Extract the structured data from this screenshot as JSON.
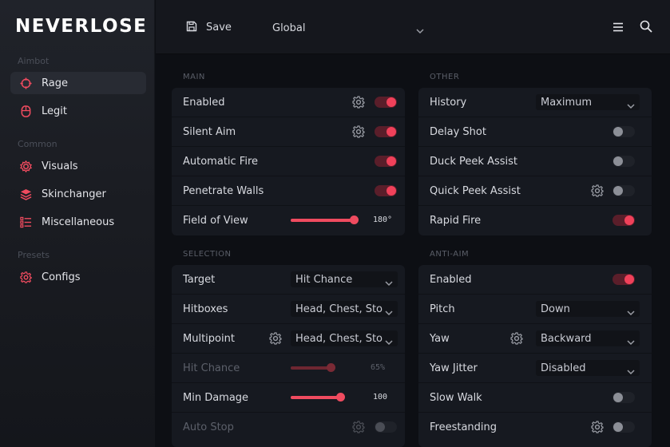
{
  "app": {
    "logo": "NEVERLOSE"
  },
  "sidebar": {
    "sections": [
      {
        "title": "Aimbot",
        "items": [
          {
            "label": "Rage",
            "icon": "crosshair-icon",
            "active": true
          },
          {
            "label": "Legit",
            "icon": "mouse-icon"
          }
        ]
      },
      {
        "title": "Common",
        "items": [
          {
            "label": "Visuals",
            "icon": "sun-icon"
          },
          {
            "label": "Skinchanger",
            "icon": "layers-icon"
          },
          {
            "label": "Miscellaneous",
            "icon": "list-icon"
          }
        ]
      },
      {
        "title": "Presets",
        "items": [
          {
            "label": "Configs",
            "icon": "gear-icon"
          }
        ]
      }
    ]
  },
  "topbar": {
    "save_label": "Save",
    "config_value": "Global"
  },
  "main_panel": {
    "title": "MAIN",
    "rows": {
      "enabled": {
        "label": "Enabled",
        "on": true
      },
      "silent_aim": {
        "label": "Silent Aim",
        "on": true
      },
      "automatic_fire": {
        "label": "Automatic Fire",
        "on": true
      },
      "penetrate_walls": {
        "label": "Penetrate Walls",
        "on": true
      },
      "field_of_view": {
        "label": "Field of View",
        "value_text": "180°",
        "fraction": 1.0
      }
    }
  },
  "selection_panel": {
    "title": "SELECTION",
    "rows": {
      "target": {
        "label": "Target",
        "value": "Hit Chance"
      },
      "hitboxes": {
        "label": "Hitboxes",
        "value": "Head, Chest, Stomach"
      },
      "multipoint": {
        "label": "Multipoint",
        "value": "Head, Chest, Stomach"
      },
      "hit_chance": {
        "label": "Hit Chance",
        "value_text": "65%",
        "fraction": 0.65
      },
      "min_damage": {
        "label": "Min Damage",
        "value_text": "100",
        "fraction": 0.8
      },
      "auto_stop": {
        "label": "Auto Stop",
        "on": false
      }
    }
  },
  "other_panel": {
    "title": "OTHER",
    "rows": {
      "history": {
        "label": "History",
        "value": "Maximum"
      },
      "delay_shot": {
        "label": "Delay Shot",
        "on": false
      },
      "duck_peek_assist": {
        "label": "Duck Peek Assist",
        "on": false
      },
      "quick_peek_assist": {
        "label": "Quick Peek Assist",
        "on": false
      },
      "rapid_fire": {
        "label": "Rapid Fire",
        "on": true
      }
    }
  },
  "antiaim_panel": {
    "title": "ANTI-AIM",
    "rows": {
      "enabled": {
        "label": "Enabled",
        "on": true
      },
      "pitch": {
        "label": "Pitch",
        "value": "Down"
      },
      "yaw": {
        "label": "Yaw",
        "value": "Backward"
      },
      "yaw_jitter": {
        "label": "Yaw Jitter",
        "value": "Disabled"
      },
      "slow_walk": {
        "label": "Slow Walk",
        "on": false
      },
      "freestanding": {
        "label": "Freestanding",
        "on": false
      }
    }
  },
  "colors": {
    "accent": "#ef4b5f",
    "sidebar_bg": "#1d2026",
    "panel_bg": "#161920"
  }
}
